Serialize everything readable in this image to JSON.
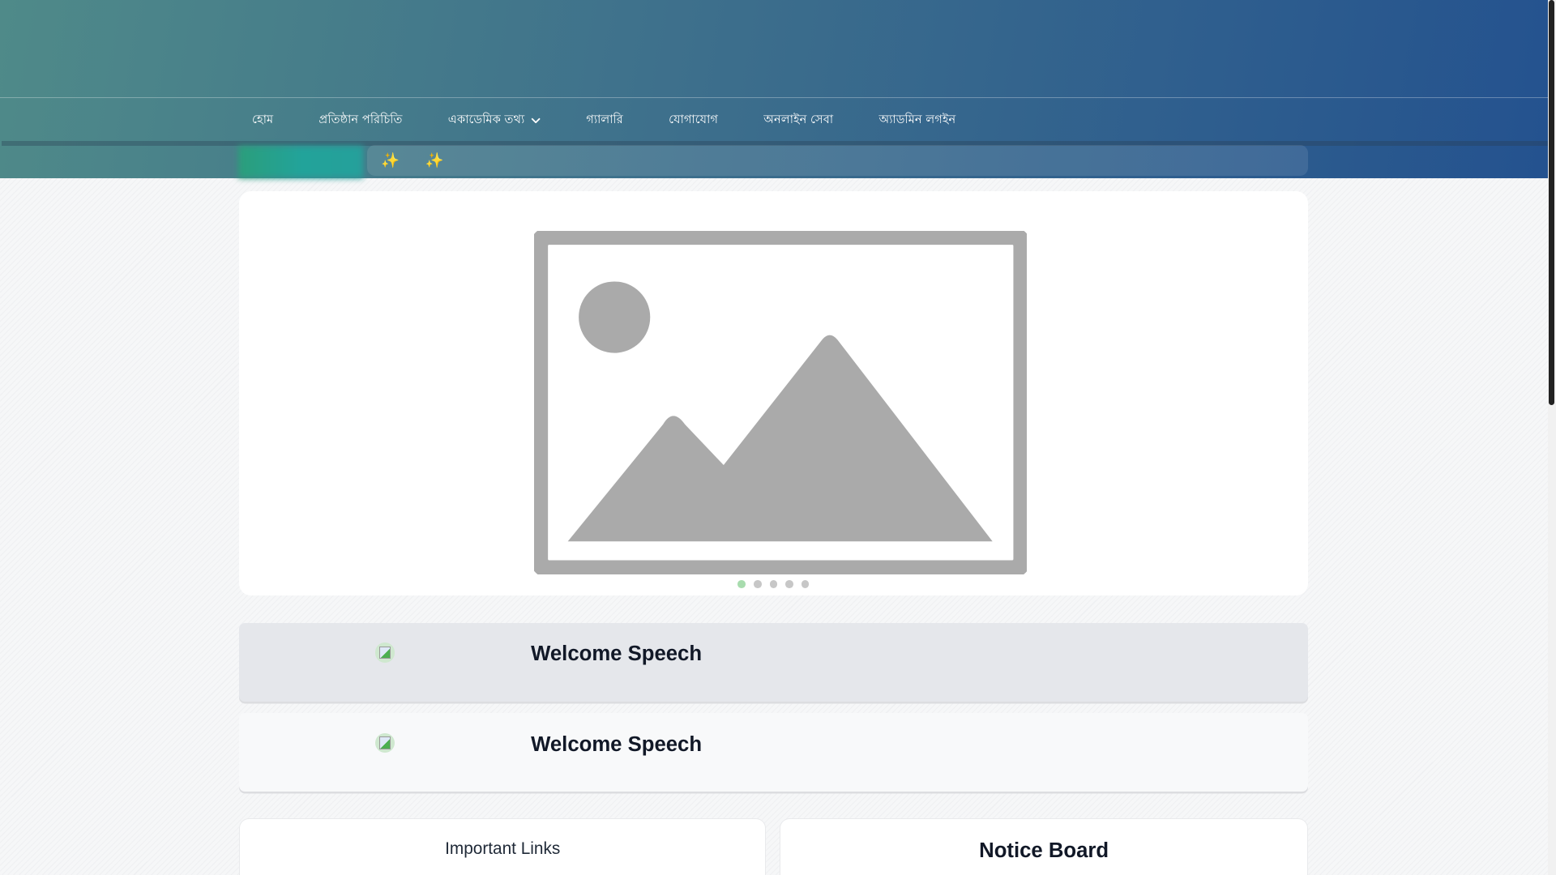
{
  "nav": {
    "items": [
      "হোম",
      "প্রতিষ্ঠান পরিচিতি",
      "একাডেমিক তথ্য",
      "গ্যালারি",
      "যোগাযোগ",
      "অনলাইন সেবা",
      "অ্যাডমিন লগইন"
    ]
  },
  "ticker": {
    "icons": [
      "✨",
      "✨"
    ]
  },
  "carousel": {
    "slides": 5,
    "active": 1
  },
  "speeches": [
    {
      "title": "Welcome Speech"
    },
    {
      "title": "Welcome Speech"
    }
  ],
  "cards": {
    "links_title": "Important Links",
    "notice_title": "Notice Board"
  },
  "colors": {
    "header_start": "#4f8a89",
    "header_end": "#24528f",
    "active_dot": "#a8dcae"
  }
}
